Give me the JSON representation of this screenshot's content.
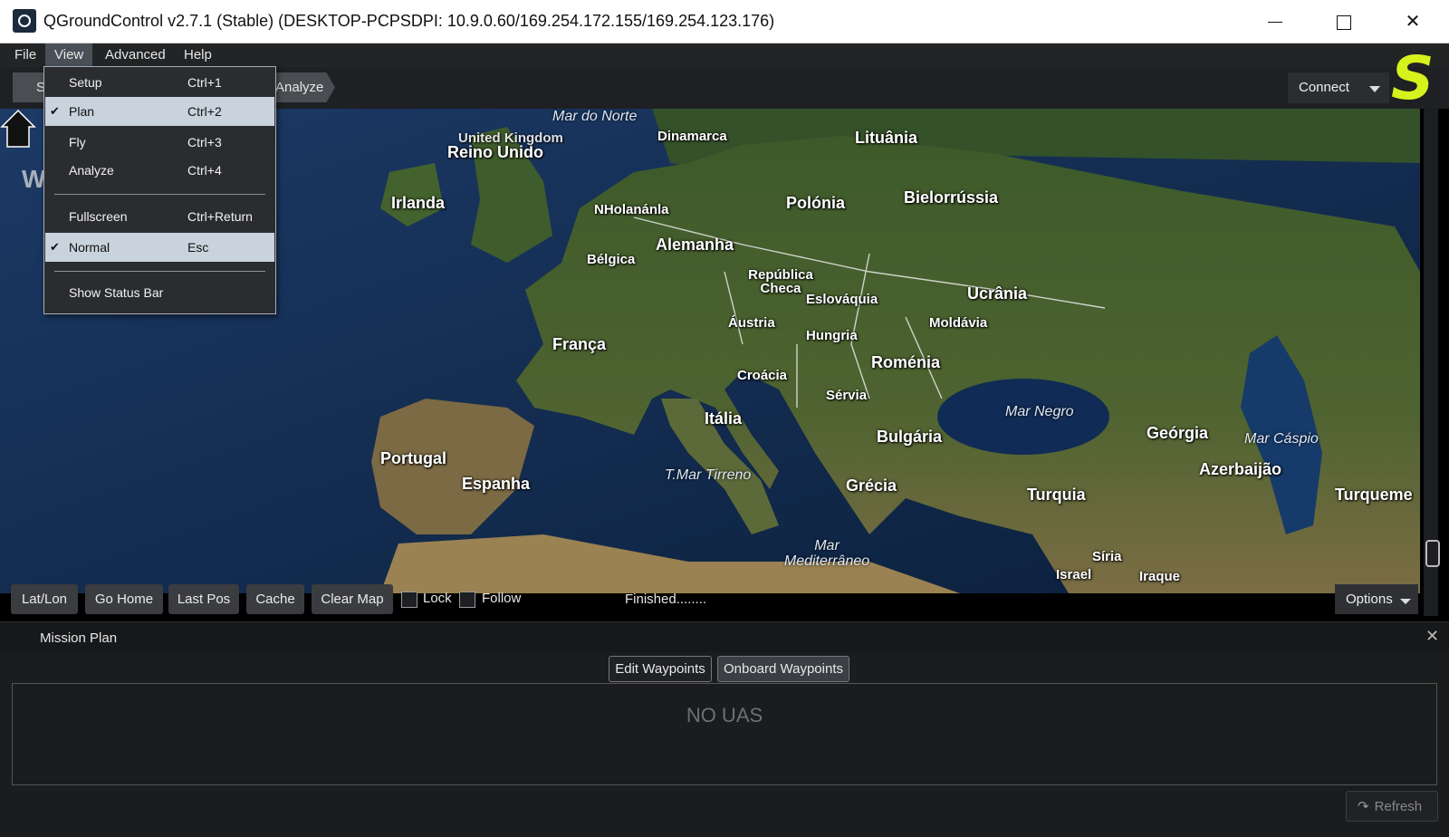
{
  "window": {
    "title": "QGroundControl v2.7.1 (Stable) (DESKTOP-PCPSDPI: 10.9.0.60/169.254.172.155/169.254.123.176)",
    "close_glyph": "✕"
  },
  "menubar": {
    "items": [
      {
        "label": "File"
      },
      {
        "label": "View"
      },
      {
        "label": "Advanced"
      },
      {
        "label": "Help"
      }
    ]
  },
  "view_menu": {
    "items": [
      {
        "label": "Setup",
        "shortcut": "Ctrl+1",
        "checked": false
      },
      {
        "label": "Plan",
        "shortcut": "Ctrl+2",
        "checked": true
      },
      {
        "label": "Fly",
        "shortcut": "Ctrl+3",
        "checked": false
      },
      {
        "label": "Analyze",
        "shortcut": "Ctrl+4",
        "checked": false
      },
      {
        "label": "Fullscreen",
        "shortcut": "Ctrl+Return",
        "checked": false
      },
      {
        "label": "Normal",
        "shortcut": "Esc",
        "checked": true
      },
      {
        "label": "Show Status Bar",
        "shortcut": "",
        "checked": false
      }
    ],
    "check_glyph": "✔"
  },
  "toolbar": {
    "setup_tab_partial": "S",
    "analyze_tab": "Analyze",
    "connect_label": "Connect",
    "logo_letter": "S",
    "logo_color": "#d6f21c"
  },
  "map": {
    "edge_partial_label": "W",
    "countries": [
      {
        "name": "Reino Unido"
      },
      {
        "name": "United Kingdom"
      },
      {
        "name": "Irlanda"
      },
      {
        "name": "Dinamarca"
      },
      {
        "name": "Lituânia"
      },
      {
        "name": "Bielorrússia"
      },
      {
        "name": "Polónia"
      },
      {
        "name": "NHolanánla"
      },
      {
        "name": "Bélgica"
      },
      {
        "name": "Alemanha"
      },
      {
        "name": "República Checa"
      },
      {
        "name": "Eslováquia"
      },
      {
        "name": "Ucrânia"
      },
      {
        "name": "Moldávia"
      },
      {
        "name": "Áustria"
      },
      {
        "name": "Hungria"
      },
      {
        "name": "França"
      },
      {
        "name": "Roménia"
      },
      {
        "name": "Croácia"
      },
      {
        "name": "Sérvia"
      },
      {
        "name": "Itália"
      },
      {
        "name": "Bulgária"
      },
      {
        "name": "Geórgia"
      },
      {
        "name": "Azerbaijão"
      },
      {
        "name": "Portugal"
      },
      {
        "name": "Espanha"
      },
      {
        "name": "Grécia"
      },
      {
        "name": "Turquia"
      },
      {
        "name": "Turqueme"
      },
      {
        "name": "Síria"
      },
      {
        "name": "Israel"
      },
      {
        "name": "Iraque"
      }
    ],
    "seas": [
      {
        "name": "Mar do Norte"
      },
      {
        "name": "Mar Negro"
      },
      {
        "name": "Mar Cáspio"
      },
      {
        "name": "T.Mar Tirreno"
      },
      {
        "name": "Mar Mediterrâneo"
      }
    ]
  },
  "map_toolbar": {
    "buttons": [
      {
        "label": "Lat/Lon"
      },
      {
        "label": "Go Home"
      },
      {
        "label": "Last Pos"
      },
      {
        "label": "Cache"
      },
      {
        "label": "Clear Map"
      }
    ],
    "lock_label": "Lock",
    "follow_label": "Follow",
    "status": "Finished........",
    "options_label": "Options"
  },
  "mission": {
    "title": "Mission Plan",
    "close_glyph": "✕",
    "tabs": [
      {
        "label": "Edit Waypoints"
      },
      {
        "label": "Onboard Waypoints"
      }
    ],
    "empty_message": "NO UAS",
    "refresh_label": "Refresh",
    "refresh_glyph": "↷"
  }
}
